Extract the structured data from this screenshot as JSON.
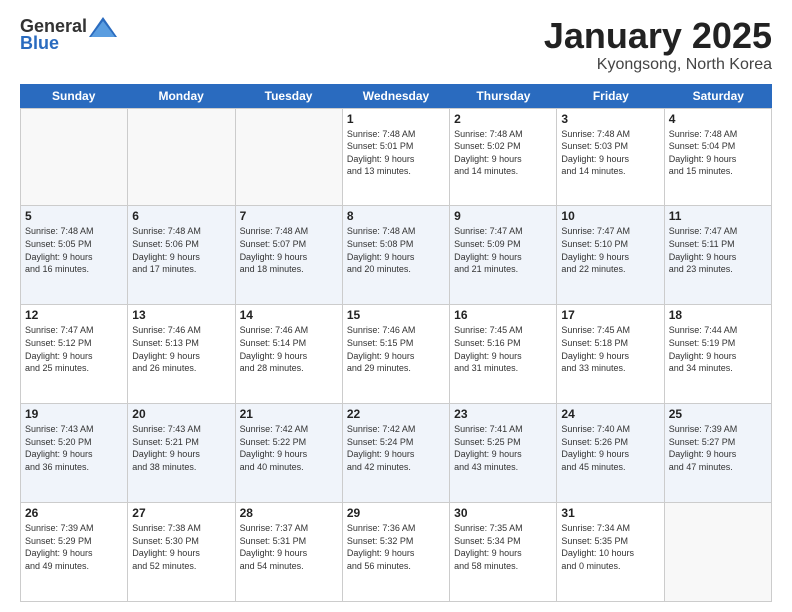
{
  "header": {
    "logo_general": "General",
    "logo_blue": "Blue",
    "month": "January 2025",
    "location": "Kyongsong, North Korea"
  },
  "days": [
    "Sunday",
    "Monday",
    "Tuesday",
    "Wednesday",
    "Thursday",
    "Friday",
    "Saturday"
  ],
  "rows": [
    {
      "shaded": false,
      "cells": [
        {
          "date": "",
          "info": ""
        },
        {
          "date": "",
          "info": ""
        },
        {
          "date": "",
          "info": ""
        },
        {
          "date": "1",
          "info": "Sunrise: 7:48 AM\nSunset: 5:01 PM\nDaylight: 9 hours\nand 13 minutes."
        },
        {
          "date": "2",
          "info": "Sunrise: 7:48 AM\nSunset: 5:02 PM\nDaylight: 9 hours\nand 14 minutes."
        },
        {
          "date": "3",
          "info": "Sunrise: 7:48 AM\nSunset: 5:03 PM\nDaylight: 9 hours\nand 14 minutes."
        },
        {
          "date": "4",
          "info": "Sunrise: 7:48 AM\nSunset: 5:04 PM\nDaylight: 9 hours\nand 15 minutes."
        }
      ]
    },
    {
      "shaded": true,
      "cells": [
        {
          "date": "5",
          "info": "Sunrise: 7:48 AM\nSunset: 5:05 PM\nDaylight: 9 hours\nand 16 minutes."
        },
        {
          "date": "6",
          "info": "Sunrise: 7:48 AM\nSunset: 5:06 PM\nDaylight: 9 hours\nand 17 minutes."
        },
        {
          "date": "7",
          "info": "Sunrise: 7:48 AM\nSunset: 5:07 PM\nDaylight: 9 hours\nand 18 minutes."
        },
        {
          "date": "8",
          "info": "Sunrise: 7:48 AM\nSunset: 5:08 PM\nDaylight: 9 hours\nand 20 minutes."
        },
        {
          "date": "9",
          "info": "Sunrise: 7:47 AM\nSunset: 5:09 PM\nDaylight: 9 hours\nand 21 minutes."
        },
        {
          "date": "10",
          "info": "Sunrise: 7:47 AM\nSunset: 5:10 PM\nDaylight: 9 hours\nand 22 minutes."
        },
        {
          "date": "11",
          "info": "Sunrise: 7:47 AM\nSunset: 5:11 PM\nDaylight: 9 hours\nand 23 minutes."
        }
      ]
    },
    {
      "shaded": false,
      "cells": [
        {
          "date": "12",
          "info": "Sunrise: 7:47 AM\nSunset: 5:12 PM\nDaylight: 9 hours\nand 25 minutes."
        },
        {
          "date": "13",
          "info": "Sunrise: 7:46 AM\nSunset: 5:13 PM\nDaylight: 9 hours\nand 26 minutes."
        },
        {
          "date": "14",
          "info": "Sunrise: 7:46 AM\nSunset: 5:14 PM\nDaylight: 9 hours\nand 28 minutes."
        },
        {
          "date": "15",
          "info": "Sunrise: 7:46 AM\nSunset: 5:15 PM\nDaylight: 9 hours\nand 29 minutes."
        },
        {
          "date": "16",
          "info": "Sunrise: 7:45 AM\nSunset: 5:16 PM\nDaylight: 9 hours\nand 31 minutes."
        },
        {
          "date": "17",
          "info": "Sunrise: 7:45 AM\nSunset: 5:18 PM\nDaylight: 9 hours\nand 33 minutes."
        },
        {
          "date": "18",
          "info": "Sunrise: 7:44 AM\nSunset: 5:19 PM\nDaylight: 9 hours\nand 34 minutes."
        }
      ]
    },
    {
      "shaded": true,
      "cells": [
        {
          "date": "19",
          "info": "Sunrise: 7:43 AM\nSunset: 5:20 PM\nDaylight: 9 hours\nand 36 minutes."
        },
        {
          "date": "20",
          "info": "Sunrise: 7:43 AM\nSunset: 5:21 PM\nDaylight: 9 hours\nand 38 minutes."
        },
        {
          "date": "21",
          "info": "Sunrise: 7:42 AM\nSunset: 5:22 PM\nDaylight: 9 hours\nand 40 minutes."
        },
        {
          "date": "22",
          "info": "Sunrise: 7:42 AM\nSunset: 5:24 PM\nDaylight: 9 hours\nand 42 minutes."
        },
        {
          "date": "23",
          "info": "Sunrise: 7:41 AM\nSunset: 5:25 PM\nDaylight: 9 hours\nand 43 minutes."
        },
        {
          "date": "24",
          "info": "Sunrise: 7:40 AM\nSunset: 5:26 PM\nDaylight: 9 hours\nand 45 minutes."
        },
        {
          "date": "25",
          "info": "Sunrise: 7:39 AM\nSunset: 5:27 PM\nDaylight: 9 hours\nand 47 minutes."
        }
      ]
    },
    {
      "shaded": false,
      "cells": [
        {
          "date": "26",
          "info": "Sunrise: 7:39 AM\nSunset: 5:29 PM\nDaylight: 9 hours\nand 49 minutes."
        },
        {
          "date": "27",
          "info": "Sunrise: 7:38 AM\nSunset: 5:30 PM\nDaylight: 9 hours\nand 52 minutes."
        },
        {
          "date": "28",
          "info": "Sunrise: 7:37 AM\nSunset: 5:31 PM\nDaylight: 9 hours\nand 54 minutes."
        },
        {
          "date": "29",
          "info": "Sunrise: 7:36 AM\nSunset: 5:32 PM\nDaylight: 9 hours\nand 56 minutes."
        },
        {
          "date": "30",
          "info": "Sunrise: 7:35 AM\nSunset: 5:34 PM\nDaylight: 9 hours\nand 58 minutes."
        },
        {
          "date": "31",
          "info": "Sunrise: 7:34 AM\nSunset: 5:35 PM\nDaylight: 10 hours\nand 0 minutes."
        },
        {
          "date": "",
          "info": ""
        }
      ]
    }
  ]
}
